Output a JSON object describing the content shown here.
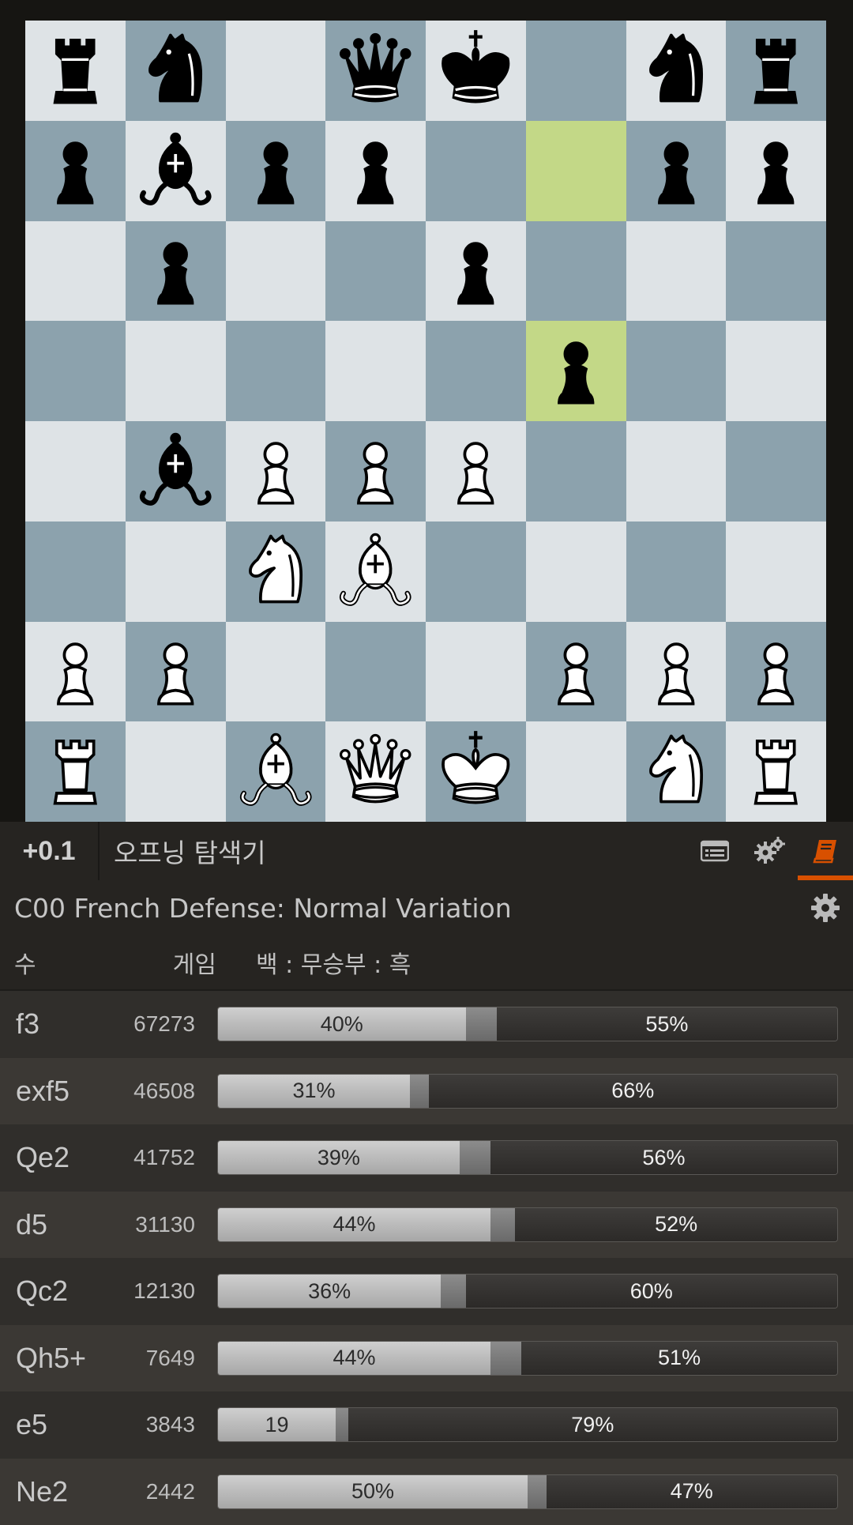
{
  "board": {
    "ranks": [
      [
        "br",
        "bn",
        "",
        "bq",
        "bk",
        "",
        "bn",
        "br"
      ],
      [
        "bp",
        "bb",
        "bp",
        "bp",
        "",
        "",
        "bp",
        "bp"
      ],
      [
        "",
        "bp",
        "",
        "",
        "bp",
        "",
        "",
        ""
      ],
      [
        "",
        "",
        "",
        "",
        "",
        "bp",
        "",
        ""
      ],
      [
        "",
        "bb",
        "wp",
        "wp",
        "wp",
        "",
        "",
        ""
      ],
      [
        "",
        "",
        "wn",
        "wb",
        "",
        "",
        "",
        ""
      ],
      [
        "wp",
        "wp",
        "",
        "",
        "",
        "wp",
        "wp",
        "wp"
      ],
      [
        "wr",
        "",
        "wb",
        "wq",
        "wk",
        "",
        "wn",
        "wr"
      ]
    ],
    "highlighted": [
      "f7",
      "f5"
    ],
    "colors": {
      "light": "#dee3e6",
      "dark": "#8ca2ad",
      "highlight": "#c3d887"
    }
  },
  "control_bar": {
    "eval": "+0.1",
    "tool_title": "오프닝 탐색기",
    "icons": [
      "moves-list-icon",
      "settings-gears-icon",
      "book-icon"
    ],
    "active_color": "#d85000"
  },
  "explorer": {
    "opening_name": "C00 French Defense: Normal Variation",
    "headers": {
      "move": "수",
      "games": "게임",
      "result": "백 : 무승부 : 흑"
    },
    "rows": [
      {
        "move": "f3",
        "games": "67273",
        "white": 40,
        "draw": 5,
        "black": 55,
        "white_label": "40%",
        "black_label": "55%"
      },
      {
        "move": "exf5",
        "games": "46508",
        "white": 31,
        "draw": 3,
        "black": 66,
        "white_label": "31%",
        "black_label": "66%"
      },
      {
        "move": "Qe2",
        "games": "41752",
        "white": 39,
        "draw": 5,
        "black": 56,
        "white_label": "39%",
        "black_label": "56%"
      },
      {
        "move": "d5",
        "games": "31130",
        "white": 44,
        "draw": 4,
        "black": 52,
        "white_label": "44%",
        "black_label": "52%"
      },
      {
        "move": "Qc2",
        "games": "12130",
        "white": 36,
        "draw": 4,
        "black": 60,
        "white_label": "36%",
        "black_label": "60%"
      },
      {
        "move": "Qh5+",
        "games": "7649",
        "white": 44,
        "draw": 5,
        "black": 51,
        "white_label": "44%",
        "black_label": "51%"
      },
      {
        "move": "e5",
        "games": "3843",
        "white": 19,
        "draw": 2,
        "black": 79,
        "white_label": "19",
        "black_label": "79%"
      },
      {
        "move": "Ne2",
        "games": "2442",
        "white": 50,
        "draw": 3,
        "black": 47,
        "white_label": "50%",
        "black_label": "47%"
      }
    ]
  }
}
